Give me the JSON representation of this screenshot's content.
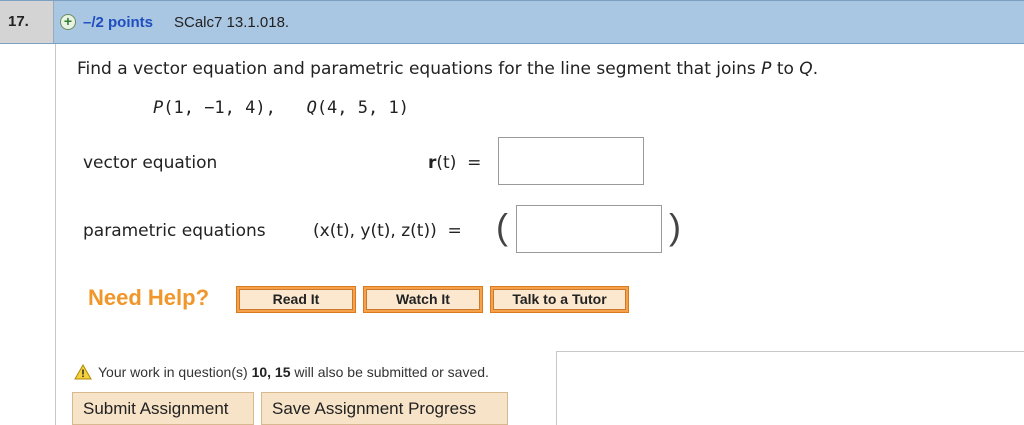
{
  "header": {
    "question_number": "17.",
    "plus_icon": "+",
    "points": "–/2 points",
    "source": "SCalc7 13.1.018."
  },
  "question": {
    "prompt_pre": "Find a vector equation and parametric equations for the line segment that joins ",
    "P": "P",
    "to": " to ",
    "Q": "Q",
    "end": ".",
    "points_text_p": "P",
    "points_text_p_coords": "(1, −1, 4),",
    "points_text_q": "Q",
    "points_text_q_coords": "(4, 5, 1)"
  },
  "vector": {
    "label": "vector equation",
    "lhs_bold": "r",
    "lhs_rest": "(t)  =",
    "value": ""
  },
  "parametric": {
    "label": "parametric equations",
    "lhs": "(x(t), y(t), z(t))  =",
    "paren_left": "(",
    "paren_right": ")",
    "value": ""
  },
  "help": {
    "title": "Need Help?",
    "read": "Read It",
    "watch": "Watch It",
    "tutor": "Talk to a Tutor"
  },
  "footer": {
    "note_pre": "Your work in question(s) ",
    "note_bold": "10, 15",
    "note_post": " will also be submitted or saved.",
    "submit": "Submit Assignment",
    "save": "Save Assignment Progress"
  },
  "colors": {
    "header_bg": "#a9c6e2",
    "points_link": "#1f4fbf",
    "need_help": "#f0962b",
    "help_button": "#f7a14a",
    "submit_button": "#f6e3c8"
  }
}
